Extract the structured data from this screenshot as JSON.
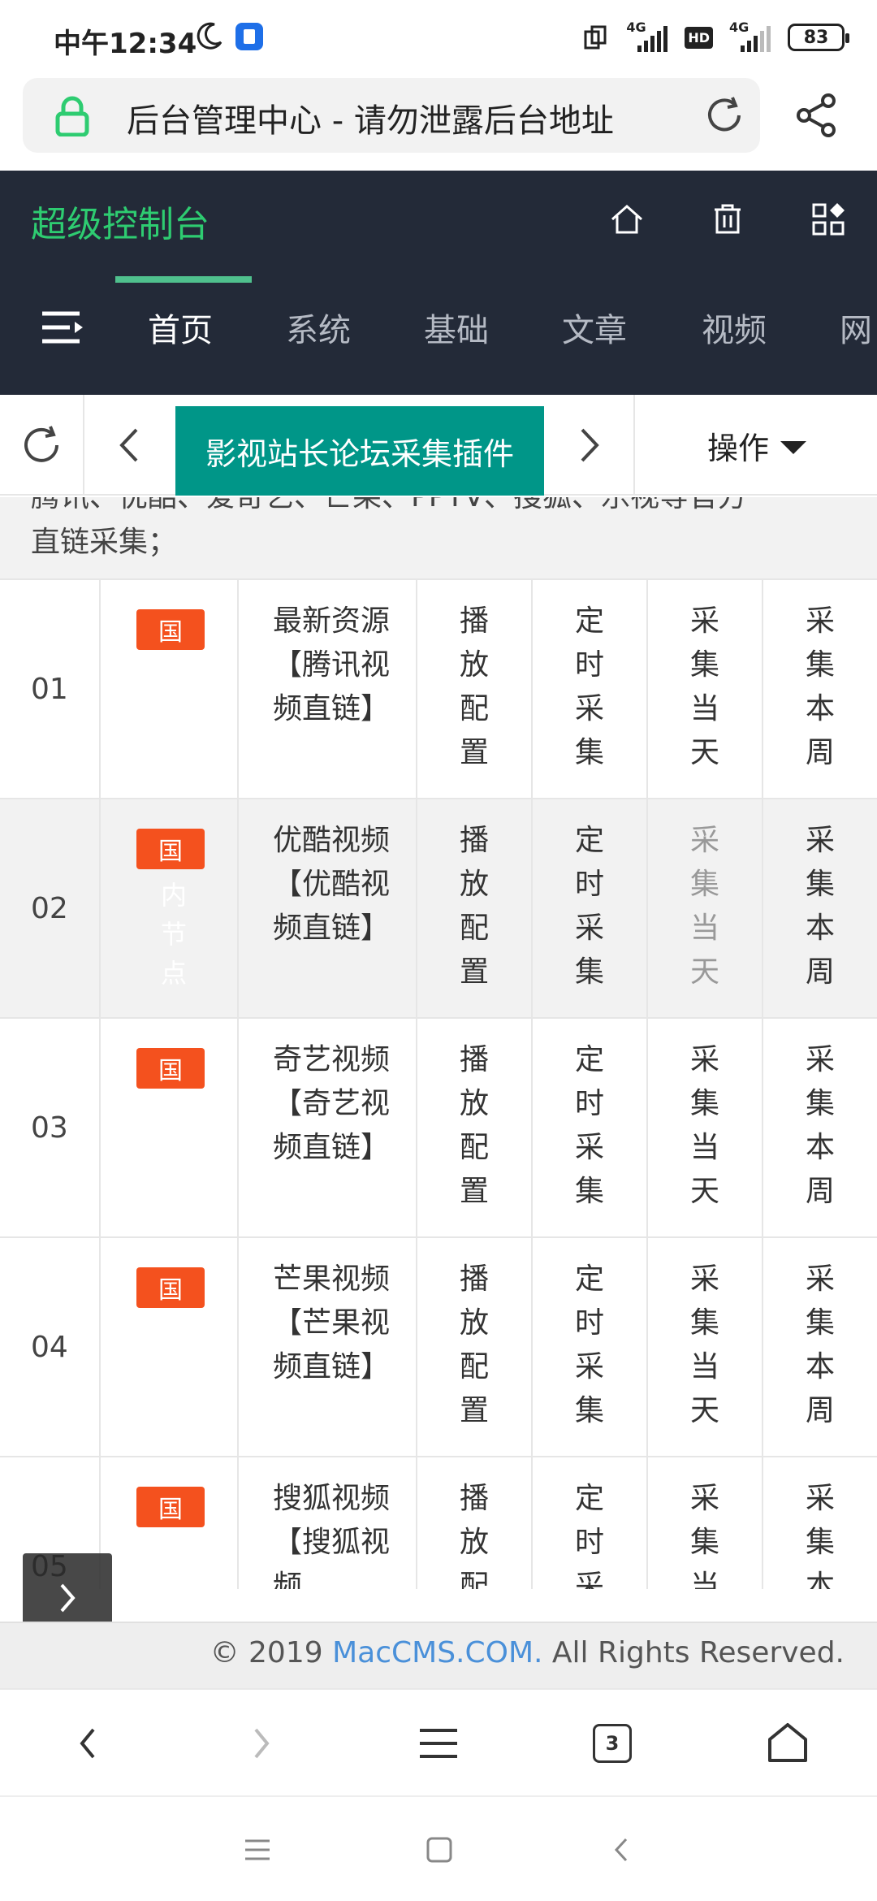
{
  "status_bar": {
    "time": "中午12:34",
    "network_1": "4G",
    "network_2": "4G",
    "hd": "HD",
    "battery": "83"
  },
  "address_bar": {
    "title": "后台管理中心 - 请勿泄露后台地址"
  },
  "header": {
    "brand": "超级控制台",
    "nav": [
      "首页",
      "系统",
      "基础",
      "文章",
      "视频",
      "网"
    ],
    "active_nav": "首页"
  },
  "tabs": {
    "active_label": "影视站长论坛采集插件",
    "operations_label": "操作"
  },
  "description": {
    "line1": "腾讯、优酷、爱奇艺、芒果、PPTV、搜狐、乐视等官方",
    "line2": "直链采集；"
  },
  "table": {
    "badge_label": "国",
    "badge_tooltip": "内节点",
    "rows": [
      {
        "num": "01",
        "name": "最新资源【腾讯视频直链】",
        "col_a": "播放配置",
        "col_b": "定时采集",
        "col_c": "采集当天",
        "col_d": "采集本周"
      },
      {
        "num": "02",
        "name": "优酷视频【优酷视频直链】",
        "col_a": "播放配置",
        "col_b": "定时采集",
        "col_c": "采集当天",
        "col_d": "采集本周"
      },
      {
        "num": "03",
        "name": "奇艺视频【奇艺视频直链】",
        "col_a": "播放配置",
        "col_b": "定时采集",
        "col_c": "采集当天",
        "col_d": "采集本周"
      },
      {
        "num": "04",
        "name": "芒果视频【芒果视频直链】",
        "col_a": "播放配置",
        "col_b": "定时采集",
        "col_c": "采集当天",
        "col_d": "采集本周"
      },
      {
        "num": "05",
        "name": "搜狐视频【搜狐视频",
        "col_a": "播放配",
        "col_b": "定时采",
        "col_c": "采集当",
        "col_d": "采集本"
      }
    ]
  },
  "footer": {
    "prefix": "© 2019 ",
    "link": "MacCMS.COM.",
    "suffix": " All Rights Reserved."
  },
  "browser_bar": {
    "tabs_count": "3"
  },
  "colors": {
    "header_bg": "#232a38",
    "brand_green": "#2ecc71",
    "active_tab": "#009688",
    "badge": "#f4511e",
    "nav_underline": "#4fc08d",
    "link_blue": "#4a90d9"
  }
}
